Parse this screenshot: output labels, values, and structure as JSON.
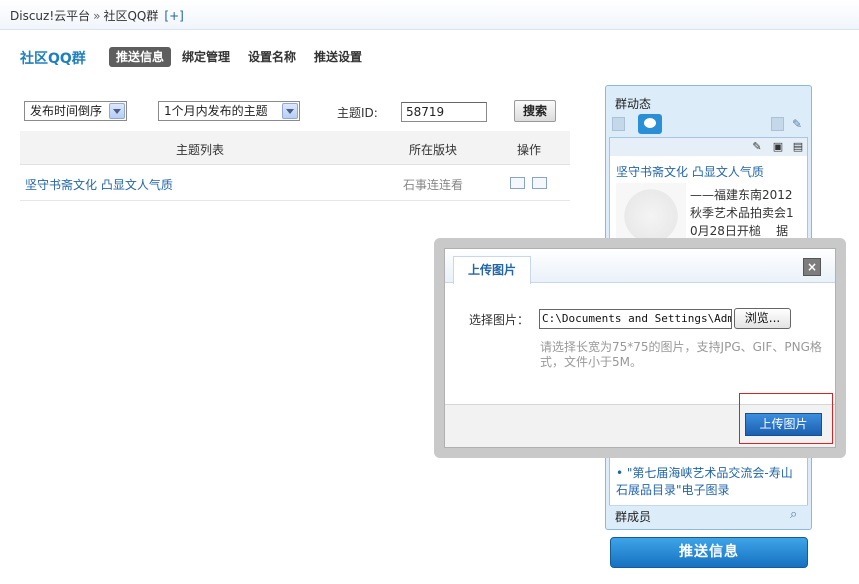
{
  "breadcrumb": {
    "root": "Discuz!云平台",
    "separator": "»",
    "current": "社区QQ群",
    "add": "[+]"
  },
  "page": {
    "title": "社区QQ群"
  },
  "nav": [
    {
      "label": "推送信息",
      "active": true
    },
    {
      "label": "绑定管理",
      "active": false
    },
    {
      "label": "设置名称",
      "active": false
    },
    {
      "label": "推送设置",
      "active": false
    }
  ],
  "filters": {
    "sort_value": "发布时间倒序",
    "range_value": "1个月内发布的主题",
    "topic_id_label": "主题ID:",
    "topic_id_value": "58719",
    "search_label": "搜索"
  },
  "table": {
    "headers": [
      "主题列表",
      "所在版块",
      "操作"
    ],
    "rows": [
      {
        "topic": "坚守书斋文化 凸显文人气质",
        "forum": "石事连连看"
      }
    ]
  },
  "widget": {
    "title": "群动态",
    "post_title": "坚守书斋文化 凸显文人气质",
    "post_text": "——福建东南2012\n秋季艺术品拍卖会1\n0月28日开槌    据",
    "list_item": "\"第七届海峡艺术品交流会-寿山石展品目录\"电子图录",
    "members_label": "群成员",
    "push_button": "推送信息"
  },
  "modal": {
    "tab": "上传图片",
    "close": "×",
    "choose_label": "选择图片：",
    "file_path": "C:\\Documents and Settings\\Admin",
    "browse": "浏览...",
    "hint": "请选择长宽为75*75的图片，支持JPG、GIF、PNG格式，文件小于5M。",
    "upload_button": "上传图片"
  },
  "colors": {
    "link": "#2366a8",
    "accent": "#1f7fbf",
    "push_button": "#1671c0",
    "highlight_border": "#dd2222"
  }
}
